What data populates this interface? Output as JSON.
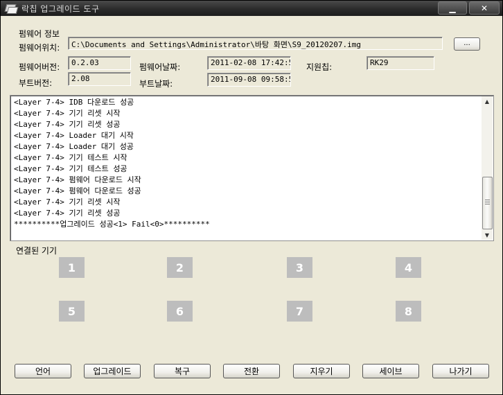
{
  "window": {
    "title": "락칩 업그레이드 도구",
    "minimize_glyph": "▁",
    "close_glyph": "✕"
  },
  "firmware": {
    "section_title": "펌웨어 정보",
    "location_label": "펌웨어위치:",
    "location_value": "C:\\Documents and Settings\\Administrator\\바탕 화면\\S9_20120207.img",
    "browse_label": "...",
    "version_label": "펌웨어버전:",
    "version_value": "0.2.03",
    "date_label": "펌웨어날짜:",
    "date_value": "2011-02-08 17:42:57",
    "chip_label": "지원칩:",
    "chip_value": "RK29",
    "boot_version_label": "부트버전:",
    "boot_version_value": "2.08",
    "boot_date_label": "부트날짜:",
    "boot_date_value": "2011-09-08 09:58:54"
  },
  "log": {
    "lines": [
      "<Layer 7-4> IDB 다운로드 성공",
      "<Layer 7-4> 기기 리셋 시작",
      "<Layer 7-4> 기기 리셋 성공",
      "<Layer 7-4> Loader 대기 시작",
      "<Layer 7-4> Loader 대기 성공",
      "<Layer 7-4> 기기 테스트 시작",
      "<Layer 7-4> 기기 테스트 성공",
      "<Layer 7-4> 펌웨어 다운로드 시작",
      "<Layer 7-4> 펌웨어 다운로드 성공",
      "<Layer 7-4> 기기 리셋 시작",
      "<Layer 7-4> 기기 리셋 성공",
      "**********업그레이드 성공<1> Fail<0>**********"
    ]
  },
  "devices": {
    "label": "연결된 기기",
    "slots": [
      "1",
      "2",
      "3",
      "4",
      "5",
      "6",
      "7",
      "8"
    ]
  },
  "buttons": {
    "language": "언어",
    "upgrade": "업그레이드",
    "restore": "복구",
    "switch": "전환",
    "clear": "지우기",
    "save": "세이브",
    "exit": "나가기"
  }
}
